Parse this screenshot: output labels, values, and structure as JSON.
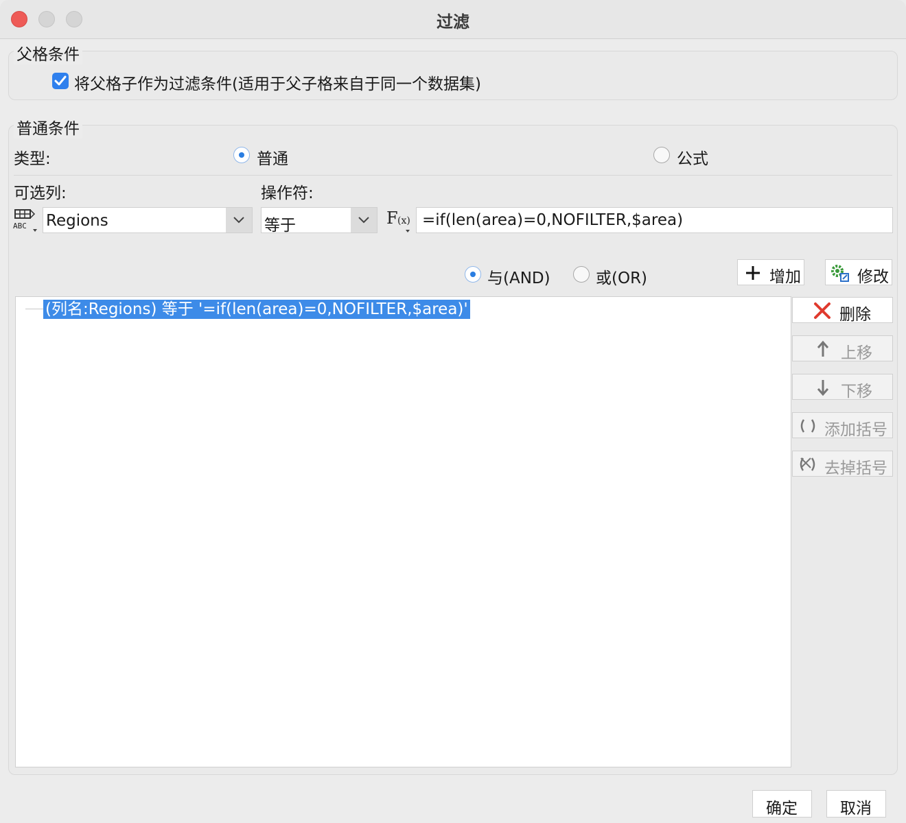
{
  "window": {
    "title": "过滤"
  },
  "parent_group": {
    "legend": "父格条件",
    "checkbox_label": "将父格子作为过滤条件(适用于父子格来自于同一个数据集)",
    "checked": true
  },
  "normal_group": {
    "legend": "普通条件",
    "type_label": "类型:",
    "type_options": [
      {
        "label": "普通",
        "selected": true
      },
      {
        "label": "公式",
        "selected": false
      }
    ],
    "column_label": "可选列:",
    "operator_label": "操作符:",
    "column_value": "Regions",
    "operator_value": "等于",
    "formula_value": "=if(len(area)=0,NOFILTER,$area)",
    "logic_options": [
      {
        "label": "与(AND)",
        "selected": true
      },
      {
        "label": "或(OR)",
        "selected": false
      }
    ],
    "add_label": "增加",
    "modify_label": "修改",
    "conditions": [
      "(列名:Regions) 等于 '=if(len(area)=0,NOFILTER,$area)'"
    ],
    "side_buttons": {
      "delete": "删除",
      "move_up": "上移",
      "move_down": "下移",
      "add_bracket": "添加括号",
      "remove_bracket": "去掉括号"
    }
  },
  "footer": {
    "ok_label": "确定",
    "cancel_label": "取消"
  }
}
